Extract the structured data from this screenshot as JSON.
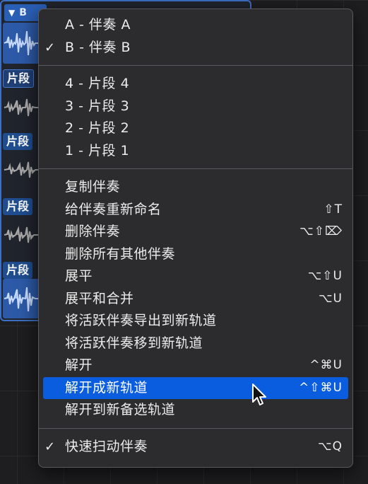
{
  "track": {
    "folder_label": "B",
    "lane_tags": [
      "片段",
      "片段",
      "片段",
      "片段",
      "片段"
    ]
  },
  "menu": {
    "sections": [
      {
        "items": [
          {
            "label": "A - 伴奏 A",
            "checked": false,
            "shortcut": ""
          },
          {
            "label": "B - 伴奏 B",
            "checked": true,
            "shortcut": ""
          }
        ]
      },
      {
        "items": [
          {
            "label": "4 - 片段 4",
            "checked": false,
            "shortcut": ""
          },
          {
            "label": "3 - 片段 3",
            "checked": false,
            "shortcut": ""
          },
          {
            "label": "2 - 片段 2",
            "checked": false,
            "shortcut": ""
          },
          {
            "label": "1 - 片段 1",
            "checked": false,
            "shortcut": ""
          }
        ]
      },
      {
        "items": [
          {
            "label": "复制伴奏",
            "shortcut": ""
          },
          {
            "label": "给伴奏重新命名",
            "shortcut": "⇧T"
          },
          {
            "label": "删除伴奏",
            "shortcut": "⌥⇧⌦"
          },
          {
            "label": "删除所有其他伴奏",
            "shortcut": ""
          },
          {
            "label": "展平",
            "shortcut": "⌥⇧U"
          },
          {
            "label": "展平和合并",
            "shortcut": "⌥U"
          },
          {
            "label": "将活跃伴奏导出到新轨道",
            "shortcut": ""
          },
          {
            "label": "将活跃伴奏移到新轨道",
            "shortcut": ""
          },
          {
            "label": "解开",
            "shortcut": "^⌘U"
          },
          {
            "label": "解开成新轨道",
            "shortcut": "^⇧⌘U",
            "highlighted": true
          },
          {
            "label": "解开到新备选轨道",
            "shortcut": ""
          }
        ]
      },
      {
        "items": [
          {
            "label": "快速扫动伴奏",
            "checked": true,
            "shortcut": "⌥Q"
          }
        ]
      }
    ],
    "check_glyph": "✓",
    "highlight_color": "#0b5de0"
  },
  "icons": {
    "collapse": "disclosure-triangle-down-icon",
    "cursor": "arrow-cursor-icon"
  }
}
